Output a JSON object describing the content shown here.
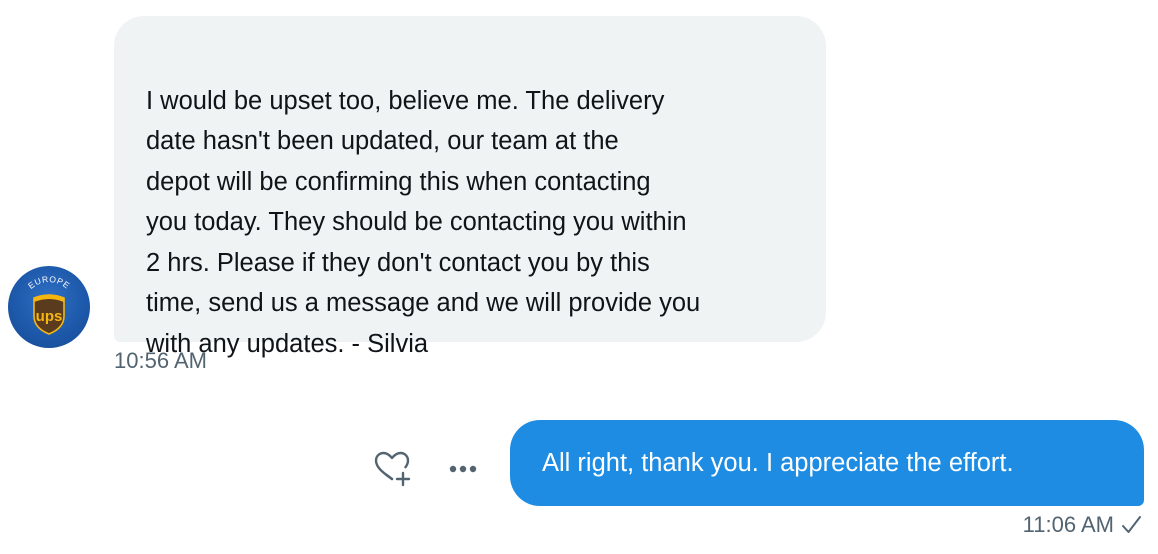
{
  "incoming": {
    "message": "I would be upset too, believe me. The delivery\ndate hasn't been updated, our team at the\ndepot will be confirming this when contacting\nyou today. They should be contacting you within\n2 hrs. Please if they don't contact you by this\ntime, send us a message and we will provide you\nwith any updates. - Silvia",
    "time": "10:56 AM",
    "avatar": {
      "badge_top": "EUROPE",
      "badge_logo": "ups",
      "icon": "ups-europe-logo"
    }
  },
  "outgoing": {
    "message": "All right, thank you. I appreciate the effort.",
    "time": "11:06 AM",
    "status_icon": "check-icon"
  },
  "actions": {
    "react_icon": "heart-plus-icon",
    "more_icon": "more-icon"
  },
  "colors": {
    "incoming_bubble": "#eff3f4",
    "outgoing_bubble": "#1d8ce2",
    "meta_text": "#536471",
    "body_text": "#0f1419",
    "ups_brown": "#5a3b1e",
    "ups_gold": "#f5b70f"
  }
}
